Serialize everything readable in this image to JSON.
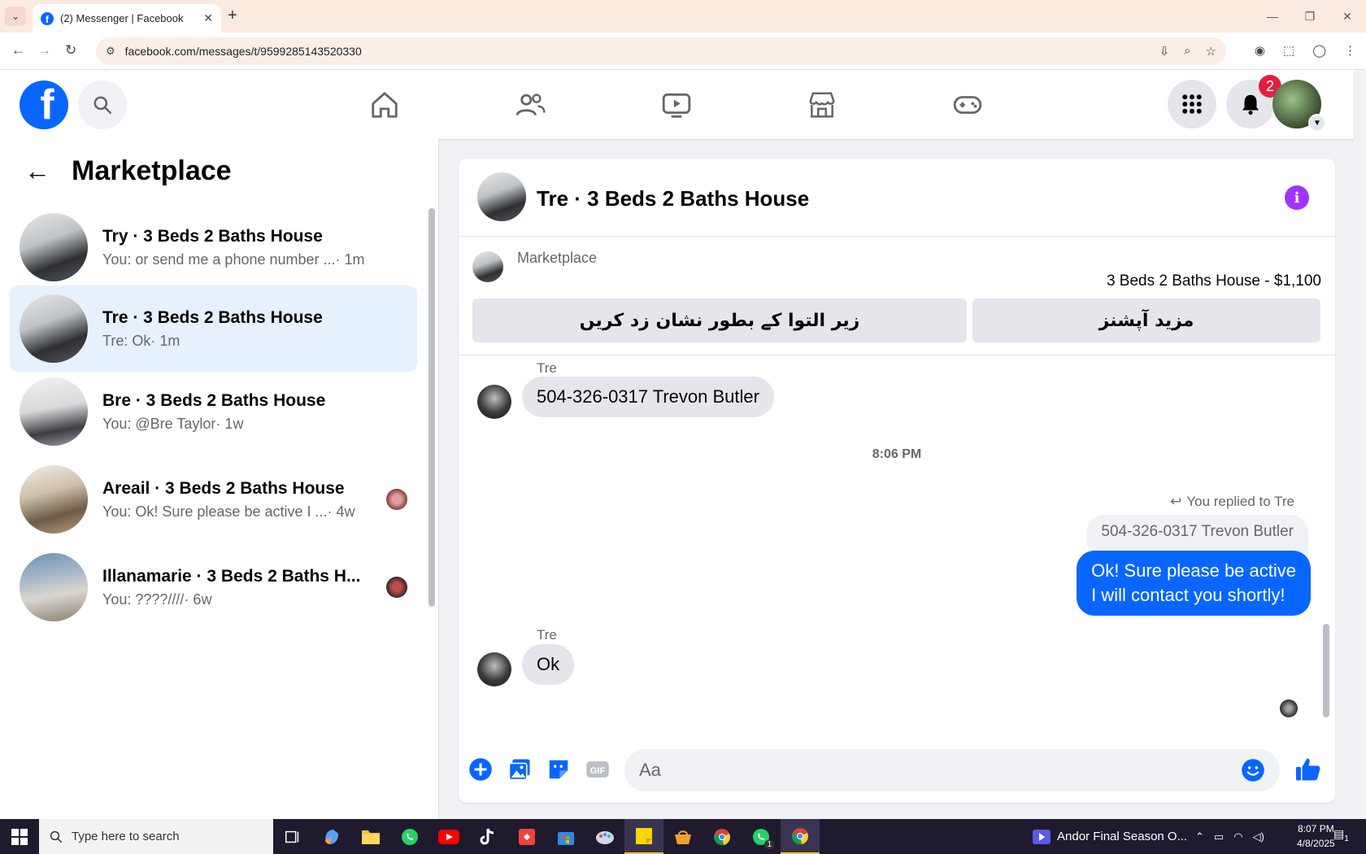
{
  "browser": {
    "tab_title": "(2) Messenger | Facebook",
    "url": "facebook.com/messages/t/9599285143520330"
  },
  "fb": {
    "notif_count": "2"
  },
  "left_panel": {
    "title": "Marketplace",
    "conversations": [
      {
        "title": "Try · 3 Beds 2 Baths House",
        "preview": "You: or send me a phone number ...",
        "time": "· 1m"
      },
      {
        "title": "Tre · 3 Beds 2 Baths House",
        "preview": "Tre: Ok",
        "time": " · 1m"
      },
      {
        "title": "Bre · 3 Beds 2 Baths House",
        "preview": "You: @Bre Taylor",
        "time": " · 1w"
      },
      {
        "title": "Areail · 3 Beds 2 Baths House",
        "preview": "You: Ok! Sure please be active I ...",
        "time": " · 4w"
      },
      {
        "title": "Illanamarie · 3 Beds 2 Baths H...",
        "preview": "You: ????////",
        "time": " · 6w"
      }
    ]
  },
  "chat": {
    "title": "Tre · 3 Beds 2 Baths House",
    "marketplace_label": "Marketplace",
    "listing": "3 Beds 2 Baths House - $1,100",
    "mark_pending_button": "زیر التوا کے بطور نشان زد کریں",
    "more_options_button": "مزید آپشنز",
    "messages": {
      "sender1": "Tre",
      "msg1": "504-326-0317 Trevon Butler",
      "time_separator": "8:06 PM",
      "replied_label": "You replied to Tre",
      "quoted": "504-326-0317 Trevon Butler",
      "out_line1": "Ok! Sure please be active",
      "out_line2": "I will contact you shortly!",
      "sender2": "Tre",
      "msg2": "Ok"
    },
    "composer_placeholder": "Aa"
  },
  "taskbar": {
    "search_placeholder": "Type here to search",
    "media_title": "Andor Final Season O...",
    "time": "8:07 PM",
    "date": "4/8/2025",
    "whatsapp_badge": "1",
    "notif_count": "1"
  }
}
